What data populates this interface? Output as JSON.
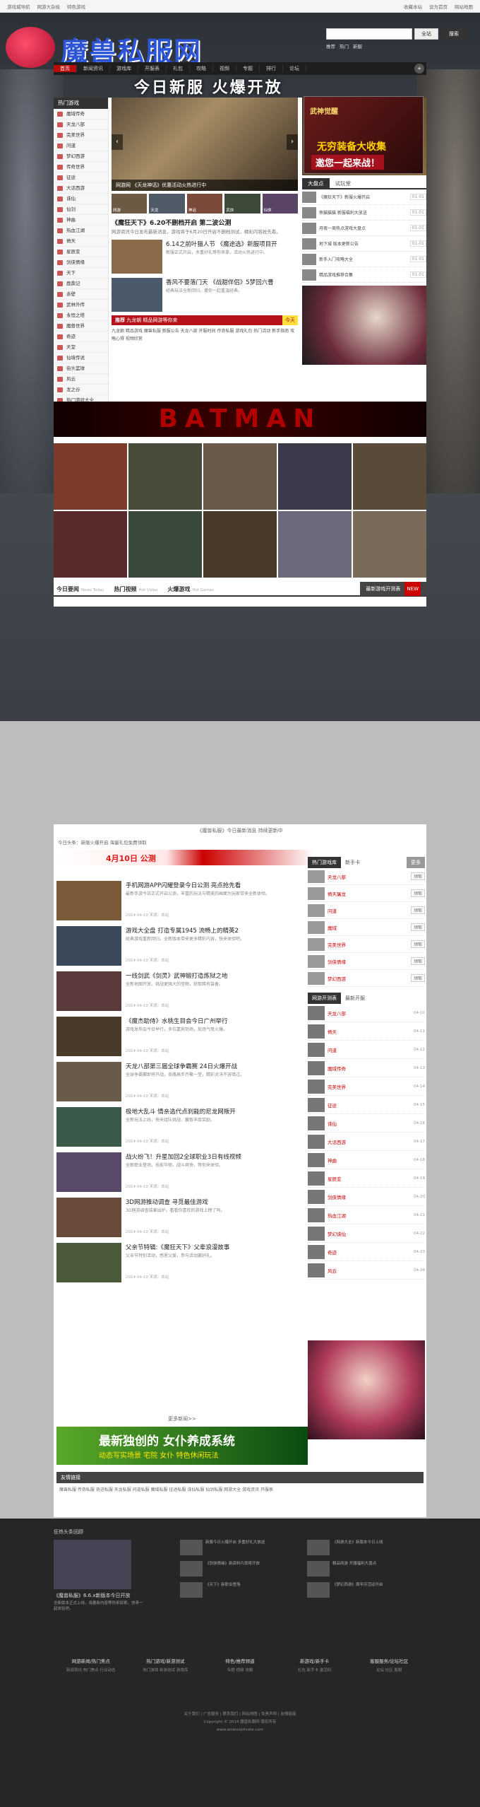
{
  "topbar": {
    "left": [
      "游戏城导航",
      "网游大杂烩",
      "特色游戏"
    ],
    "right": [
      "收藏本站",
      "设为首页",
      "网站地图"
    ]
  },
  "logo": {
    "name": "魔兽私服网",
    "url": "www.wowusprlvate.com"
  },
  "search": {
    "placeholder": "",
    "select": "全站",
    "button": "搜索",
    "hot": [
      "推荐",
      "热门",
      "新服"
    ]
  },
  "nav": {
    "items": [
      "首页",
      "新闻资讯",
      "游戏库",
      "开服表",
      "礼包",
      "攻略",
      "视频",
      "专题",
      "排行",
      "论坛"
    ],
    "plus": "+"
  },
  "banner": {
    "title": "今日新服 火爆开放"
  },
  "hero_ad": {
    "top": "武神觉醒",
    "t1": "无穷装备大收集",
    "t2": "邀您一起来战！"
  },
  "left_games": {
    "header": "热门游戏",
    "items": [
      "魔域传奇",
      "天龙八部",
      "完美世界",
      "问道",
      "梦幻西游",
      "传奇世界",
      "征途",
      "大话西游",
      "诛仙",
      "仙剑",
      "神曲",
      "热血江湖",
      "倚天",
      "星辰变",
      "剑侠情缘",
      "天下",
      "鹿鼎记",
      "赤壁",
      "武林外传",
      "永恒之塔",
      "魔兽世界",
      "奇迹",
      "天堂",
      "仙境传说",
      "街头篮球",
      "风云",
      "龙之谷",
      "热门游戏大全"
    ]
  },
  "slider": {
    "caption": "网游网 《天龙神话》优惠活动火热进行中",
    "prev": "‹",
    "next": "›",
    "thumbs": [
      "网游",
      "天龙",
      "神话",
      "武侠",
      "仙侠"
    ]
  },
  "headlines": [
    {
      "title": "《魔狂天下》6.20不删档开启 第二波公测",
      "summary": "网游资讯今日发布最新消息，游戏将于6月20日开启不删档测试，精彩内容抢先看。"
    },
    {
      "title": "6.14之前叶猫人节 《魔途选》新服项目开",
      "summary": "新服正式开启，多重好礼等你来拿，活动火热进行中。"
    },
    {
      "title": "香风不要落门天 《战甜伴侣》5梦回六曹",
      "summary": "经典玩法全新回归，邀你一起重温经典。"
    }
  ],
  "strip": {
    "label": "推荐",
    "text": "九龙朝 精品网游等你来",
    "tag": "今天"
  },
  "links": "九龙朝 精品游戏 魔兽私服 新服公告 天龙八部 开服时间 传奇私服 游戏礼包 热门活动 新手指南 攻略心得 视频欣赏",
  "right_tabs": [
    "大盘点",
    "试玩堂"
  ],
  "right_list": [
    {
      "t": "《魔狂天下》新服火爆开启",
      "d": "01-01"
    },
    {
      "t": "熊猫猫猫 新服福利大放送",
      "d": "01-01"
    },
    {
      "t": "月夜一周热点游戏大盘点",
      "d": "01-01"
    },
    {
      "t": "地下城 版本更新公告",
      "d": "01-01"
    },
    {
      "t": "新手入门攻略大全",
      "d": "01-01"
    },
    {
      "t": "精品游戏推荐合集",
      "d": "01-01"
    }
  ],
  "batman": "BATMAN",
  "tabs": [
    {
      "t": "今日要闻",
      "s": "News Today"
    },
    {
      "t": "热门视频",
      "s": "Hot Video"
    },
    {
      "t": "火爆游戏",
      "s": "Hot Games"
    }
  ],
  "tabs_dark": {
    "t": "最新游戏开测表",
    "hot": "NEW"
  },
  "lower": {
    "sub_title": "《魔兽私服》今日最新消息 持续更新中",
    "ticker": "今日头条：新服火爆开启 海量礼包免费领取",
    "banner": "4月10日 公测"
  },
  "feed": [
    {
      "t": "手机网游APP闪耀登录今日公测 亮点抢先看",
      "d": "最新手游今日正式开启公测，丰富的玩法与精美的画面为玩家带来全新体验。",
      "m": "2014-04-10 来源：本站"
    },
    {
      "t": "游戏大全盘 打造专属1945 流畅上的精英2",
      "d": "经典游戏重新回归，全新版本带来更多精彩内容，快来体验吧。",
      "m": "2014-04-10 来源：本站"
    },
    {
      "t": "一线剑武《剑灵》武神锻打造炼狱之地",
      "d": "全新地图开放，挑战更强大的怪物，获取稀有装备。",
      "m": "2014-04-10 来源：本站"
    },
    {
      "t": "《魔杰助侍》水桃生目会今日广州举行",
      "d": "游戏发布会今日举行，多位嘉宾到场，现场气氛火爆。",
      "m": "2014-04-10 来源：本站"
    },
    {
      "t": "天龙八部第三届全球争霸赛 24日火爆开战",
      "d": "全球争霸赛即将开战，各路高手齐聚一堂，精彩对决不容错过。",
      "m": "2014-04-10 来源：本站"
    },
    {
      "t": "极地大乱斗 情亲选代点刹能的尼龙网叛开",
      "d": "全新玩法上线，快来组队挑战，赢取丰厚奖励。",
      "m": "2014-04-10 来源：本站"
    },
    {
      "t": "战火纷飞！升星加回2全球职业3日有线视频",
      "d": "全新职业登场，技能华丽，战斗爽快，等你来体验。",
      "m": "2014-04-10 来源：本站"
    },
    {
      "t": "3D网游推动调查 寻觅最佳游戏",
      "d": "3D网游调查结果出炉，看看你喜欢的游戏上榜了吗。",
      "m": "2014-04-10 来源：本站"
    },
    {
      "t": "父亲节特辑:《魔狂天下》父辈浪漫故事",
      "d": "父亲节特别活动，感恩父爱，参与活动赢好礼。",
      "m": "2014-04-10 来源：本站"
    }
  ],
  "feed_more": "更多新闻>>",
  "side": {
    "tab_a": "热门游戏库",
    "tab_b": "新手卡",
    "more": "更多",
    "games": [
      {
        "n": "天龙八部",
        "s": "开放时间"
      },
      {
        "n": "倚天屠龙",
        "s": "开放时间"
      },
      {
        "n": "问道",
        "s": "开放时间"
      },
      {
        "n": "魔域",
        "s": "开放时间"
      },
      {
        "n": "完美世界",
        "s": "开放时间"
      },
      {
        "n": "剑侠情缘",
        "s": "开放时间"
      },
      {
        "n": "梦幻西游",
        "s": "开放时间"
      }
    ],
    "btn": "领取",
    "tab2_a": "网游开测表",
    "tab2_b": "最新开服",
    "open": [
      {
        "n": "天龙八部",
        "s": "新服开启",
        "d": "04-10"
      },
      {
        "n": "倚天",
        "s": "新服开启",
        "d": "04-11"
      },
      {
        "n": "问道",
        "s": "新服开启",
        "d": "04-12"
      },
      {
        "n": "魔域传奇",
        "s": "新服开启",
        "d": "04-13"
      },
      {
        "n": "完美世界",
        "s": "新服开启",
        "d": "04-14"
      },
      {
        "n": "征途",
        "s": "新服开启",
        "d": "04-15"
      },
      {
        "n": "诛仙",
        "s": "新服开启",
        "d": "04-16"
      },
      {
        "n": "大话西游",
        "s": "新服开启",
        "d": "04-17"
      },
      {
        "n": "神曲",
        "s": "新服开启",
        "d": "04-18"
      },
      {
        "n": "星辰变",
        "s": "新服开启",
        "d": "04-19"
      },
      {
        "n": "剑侠情缘",
        "s": "新服开启",
        "d": "04-20"
      },
      {
        "n": "热血江湖",
        "s": "新服开启",
        "d": "04-21"
      },
      {
        "n": "梦幻诛仙",
        "s": "新服开启",
        "d": "04-22"
      },
      {
        "n": "奇迹",
        "s": "新服开启",
        "d": "04-23"
      },
      {
        "n": "风云",
        "s": "新服开启",
        "d": "04-24"
      }
    ]
  },
  "bottom_ad": {
    "t": "最新独创的 女仆养成系统",
    "s": "动态写实场景 宅院 女仆 特色休闲玩法"
  },
  "friend": {
    "title": "友情链接",
    "links": "魔兽私服  传奇私服  奇迹私服  天龙私服  问道私服  魔域私服  征途私服  诛仙私服  仙剑私服  网游大全  游戏资讯  开服表"
  },
  "footer": {
    "title": "狂热头条回顾",
    "pic_cap": "《魔兽私服》6.6.x新版本今日开放",
    "pic_desc": "全新版本正式上线，海量新内容等你来探索，快来一起体验吧。",
    "items": [
      "新服今日火爆开启 多重好礼大放送",
      "《网游大全》新版本今日上线",
      "《剑侠情缘》新资料片即将开放",
      "精品网游 开服福利大盘点",
      "《天下》新职业登场",
      "《梦幻西游》周年庆活动开启"
    ],
    "nav": [
      {
        "h": "网游新闻/热门焦点",
        "s": "新闻资讯 热门焦点 行业动态"
      },
      {
        "h": "热门游戏/新游测试",
        "s": "热门游戏 新游测试 游戏库"
      },
      {
        "h": "特色/推荐频道",
        "s": "专题 视频 攻略"
      },
      {
        "h": "新游戏/新手卡",
        "s": "礼包 新手卡 激活码"
      },
      {
        "h": "客服服务/论坛社区",
        "s": "论坛 社区 客服"
      }
    ],
    "copy1": "关于我们 | 广告服务 | 联系我们 | 网站地图 | 免责声明 | 友情链接",
    "copy2": "Copyright © 2014 魔兽私服网 版权所有",
    "copy3": "www.wowusprlvate.com"
  }
}
